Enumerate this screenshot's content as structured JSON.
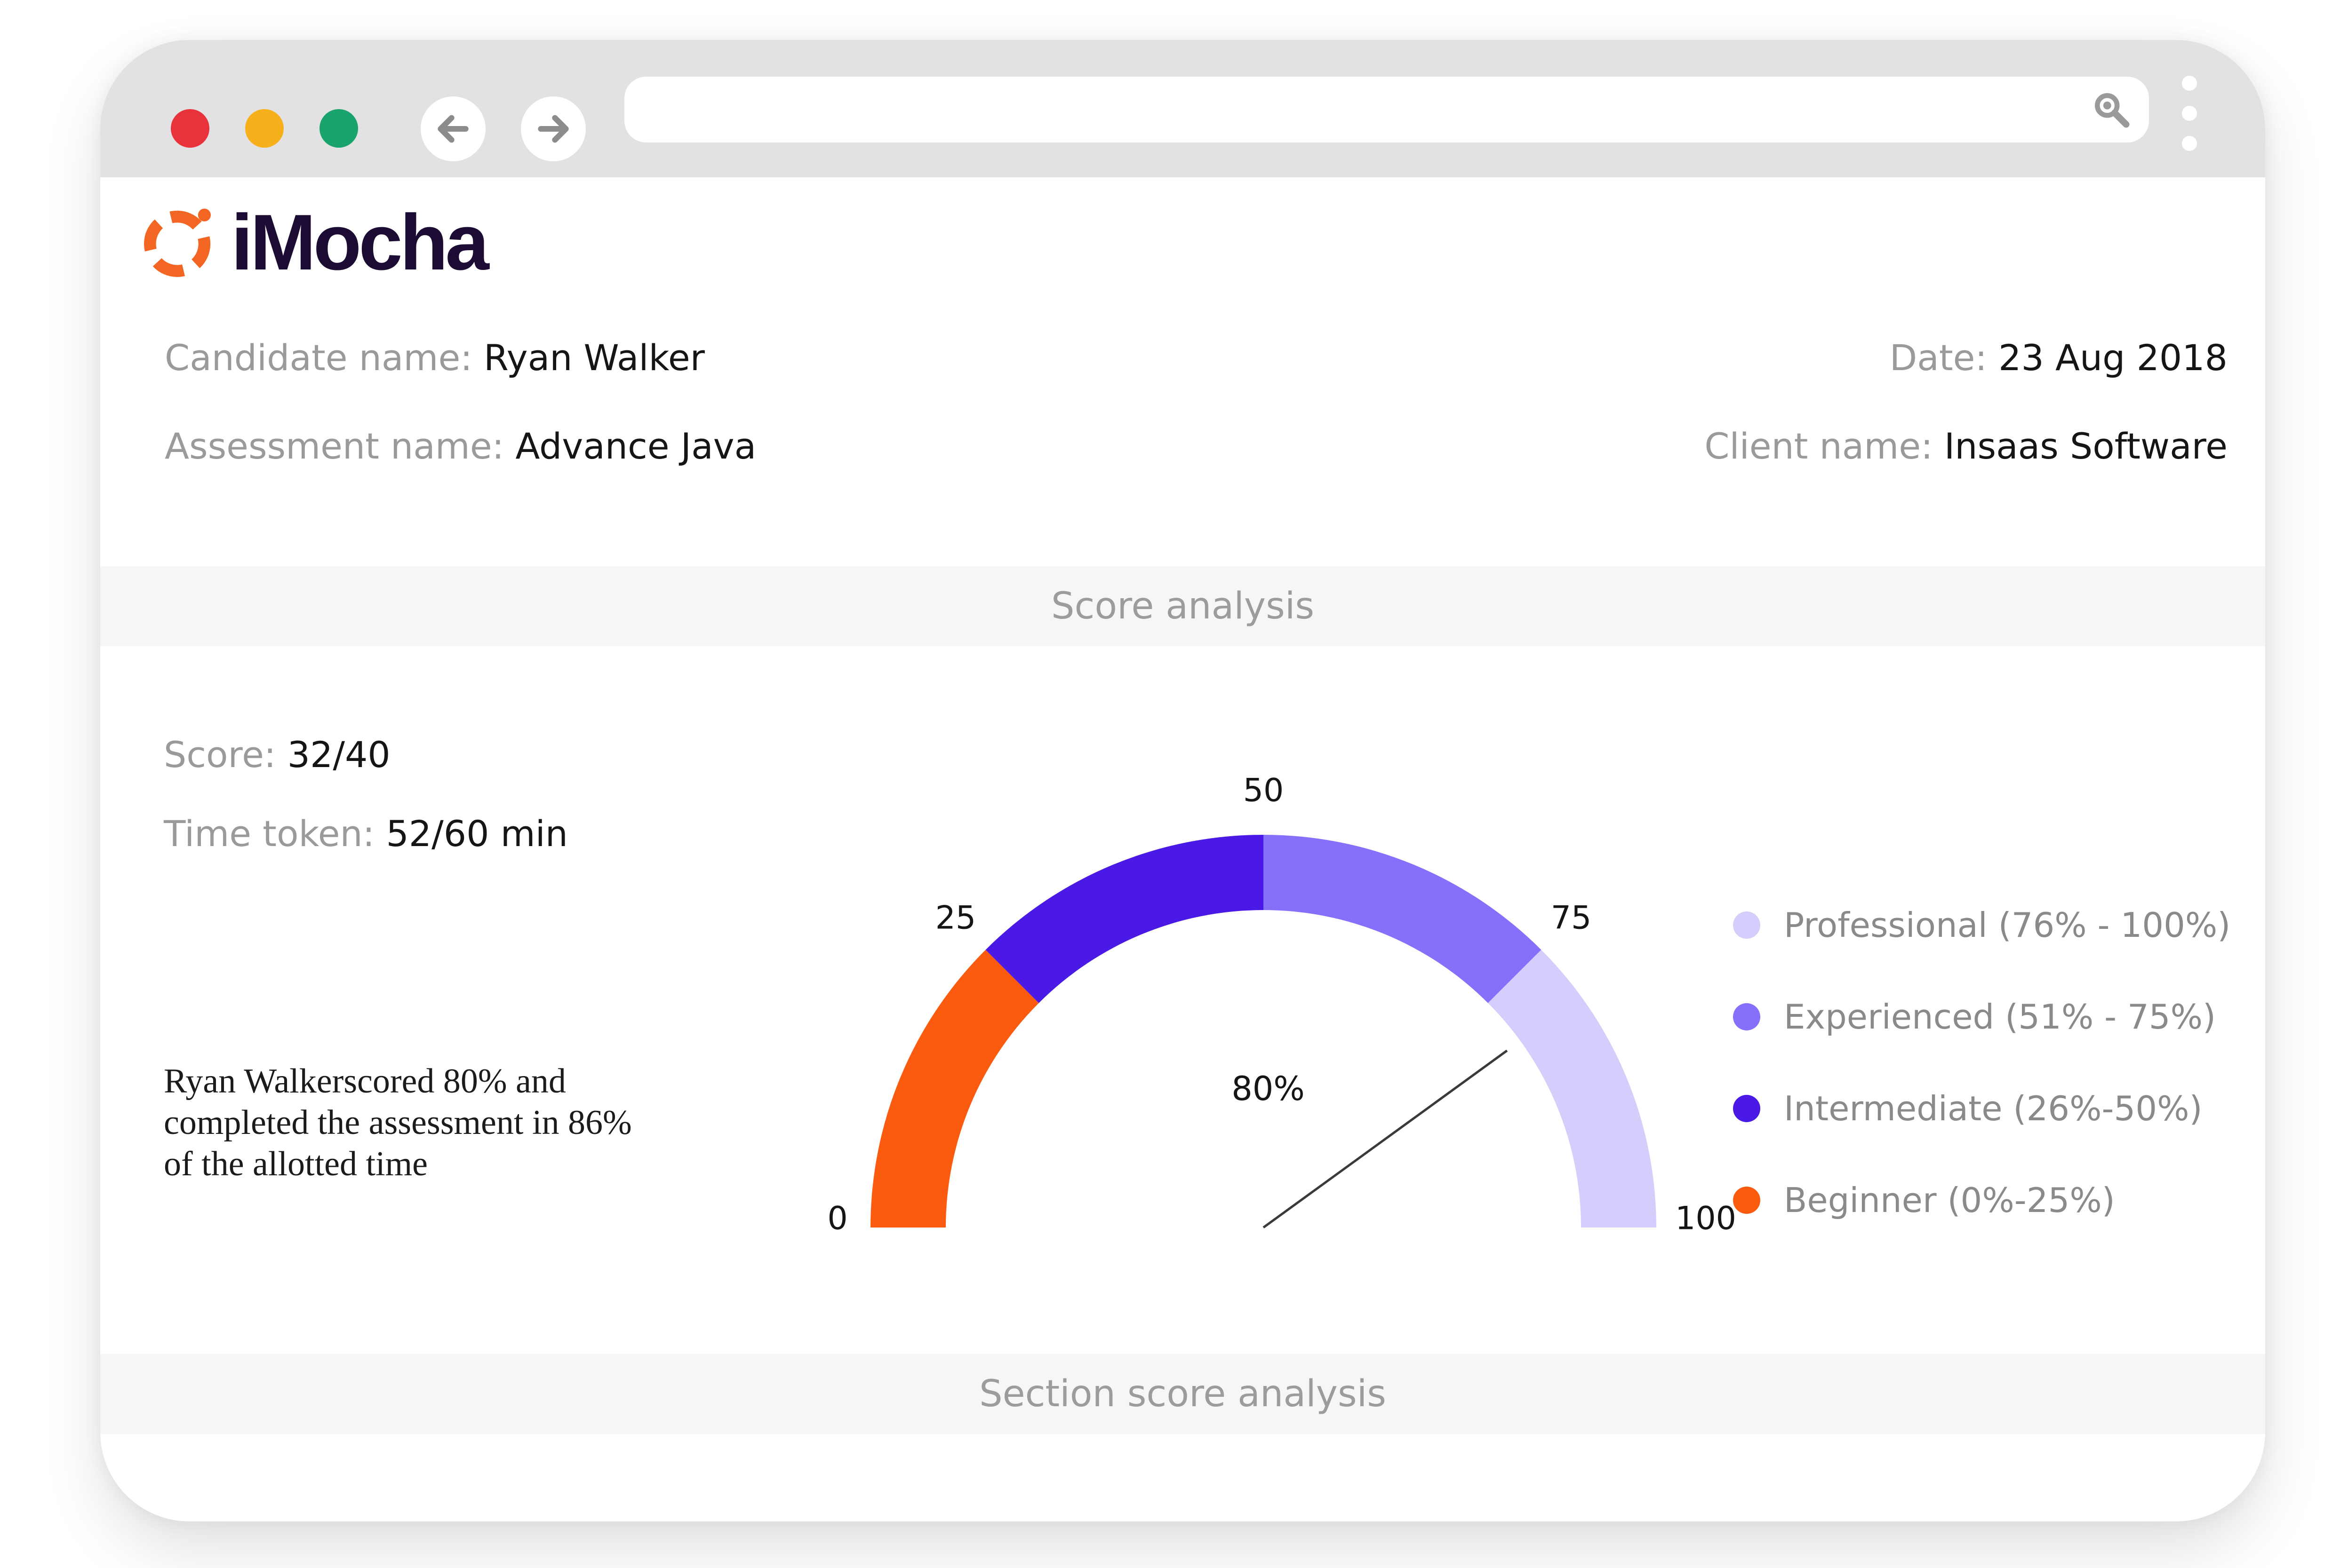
{
  "brand": {
    "name": "iMocha",
    "accent": "#f26522",
    "text_color": "#1c0b33"
  },
  "browser": {
    "controls": [
      "close",
      "minimize",
      "maximize"
    ],
    "nav_icons": [
      "arrow-left-icon",
      "arrow-right-icon"
    ],
    "url": "",
    "search_icon": "magnifier-icon",
    "menu_icon": "kebab-menu-icon"
  },
  "report": {
    "candidate": {
      "label": "Candidate name:",
      "value": "Ryan Walker"
    },
    "date": {
      "label": "Date:",
      "value": "23 Aug 2018"
    },
    "assessment": {
      "label": "Assessment name:",
      "value": "Advance Java"
    },
    "client": {
      "label": "Client name:",
      "value": "Insaas Software"
    },
    "score_section_title": "Score analysis",
    "score": {
      "label": "Score:",
      "value": "32/40"
    },
    "time": {
      "label": "Time token:",
      "value": "52/60 min"
    },
    "summary": "Ryan Walkerscored 80% and completed the assessment in 86% of the allotted time",
    "section_score_title": "Section score analysis"
  },
  "chart_data": {
    "type": "gauge",
    "min": 0,
    "max": 100,
    "value": 80,
    "value_label": "80%",
    "tick_labels": [
      "0",
      "25",
      "50",
      "75",
      "100"
    ],
    "bands": [
      {
        "name": "Beginner (0%-25%)",
        "from": 0,
        "to": 25,
        "color": "#fb5b0f"
      },
      {
        "name": "Intermediate (26%-50%)",
        "from": 25,
        "to": 50,
        "color": "#4b19e6"
      },
      {
        "name": "Experienced (51% - 75%)",
        "from": 50,
        "to": 75,
        "color": "#8470fa"
      },
      {
        "name": "Professional (76% - 100%)",
        "from": 75,
        "to": 100,
        "color": "#d3cefb"
      }
    ],
    "legend_order": [
      3,
      2,
      1,
      0
    ],
    "legend_placement": "right"
  }
}
